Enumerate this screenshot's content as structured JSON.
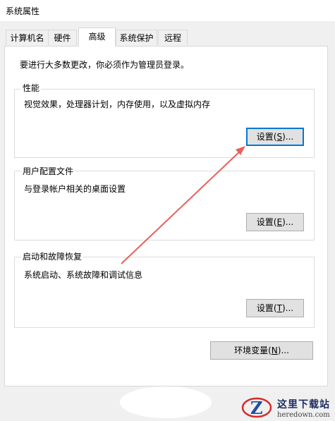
{
  "window": {
    "title": "系统属性"
  },
  "tabs": [
    {
      "label": "计算机名"
    },
    {
      "label": "硬件"
    },
    {
      "label": "高级"
    },
    {
      "label": "系统保护"
    },
    {
      "label": "远程"
    }
  ],
  "notice": "要进行大多数更改，你必须作为管理员登录。",
  "performance": {
    "title": "性能",
    "description": "视觉效果，处理器计划，内存使用，以及虚拟内存",
    "button_text": "设置(",
    "button_key": "S",
    "button_tail": ")..."
  },
  "user_profiles": {
    "title": "用户配置文件",
    "description": "与登录帐户相关的桌面设置",
    "button_text": "设置(",
    "button_key": "E",
    "button_tail": ")..."
  },
  "startup_recovery": {
    "title": "启动和故障恢复",
    "description": "系统启动、系统故障和调试信息",
    "button_text": "设置(",
    "button_key": "T",
    "button_tail": ")..."
  },
  "env_vars": {
    "button_text": "环境变量(",
    "button_key": "N",
    "button_tail": ")..."
  },
  "watermark": {
    "main": "这里下载站",
    "sub": "heredown.com"
  },
  "colors": {
    "annotation_arrow": "#e8605a",
    "focus_border": "#0078d7"
  }
}
